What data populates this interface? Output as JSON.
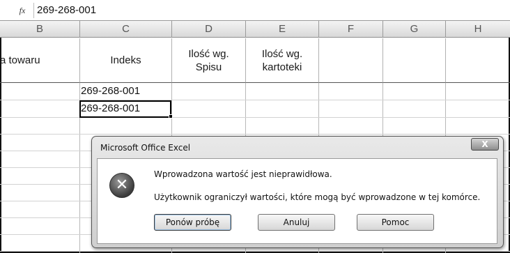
{
  "formula_bar": {
    "fx_label": "fx",
    "value": "269-268-001"
  },
  "columns": [
    "B",
    "C",
    "D",
    "E",
    "F",
    "G",
    "H"
  ],
  "sheet_header": {
    "b": "a towaru",
    "c": "Indeks",
    "d_line1": "Ilość wg.",
    "d_line2": "Spisu",
    "e_line1": "Ilość wg.",
    "e_line2": "kartoteki"
  },
  "cells": {
    "c_row1": "269-268-001",
    "c_row2": "269-268-001"
  },
  "dialog": {
    "title": "Microsoft Office Excel",
    "close_label": "X",
    "error_icon": "error-x-icon",
    "message_line1": "Wprowadzona wartość jest nieprawidłowa.",
    "message_line2": "Użytkownik ograniczył wartości, które mogą być wprowadzone w tej komórce.",
    "retry_label": "Ponów próbę",
    "cancel_label": "Anuluj",
    "help_label": "Pomoc"
  }
}
